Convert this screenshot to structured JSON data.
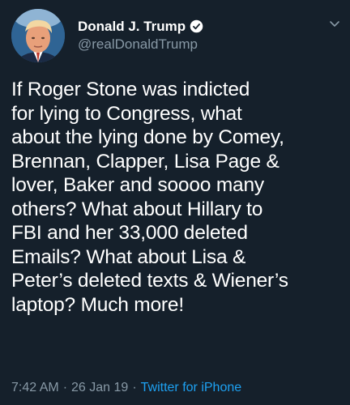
{
  "user": {
    "display_name": "Donald J. Trump",
    "handle": "@realDonaldTrump",
    "verified": true
  },
  "tweet": {
    "text": "If Roger Stone was indicted\nfor lying to Congress, what\nabout the lying done by Comey,\nBrennan, Clapper, Lisa Page &\nlover, Baker and soooo many\nothers? What about Hillary to\nFBI and her 33,000 deleted\nEmails? What about Lisa &\nPeter’s deleted texts & Wiener’s\nlaptop? Much more!",
    "time": "7:42 AM",
    "date": "26 Jan 19",
    "source": "Twitter for iPhone",
    "separator": "·"
  },
  "icons": {
    "verified": "verified-badge-icon",
    "menu": "chevron-down-icon"
  },
  "colors": {
    "background": "#15202b",
    "secondary_text": "#8899a6",
    "link": "#1da1f2"
  }
}
